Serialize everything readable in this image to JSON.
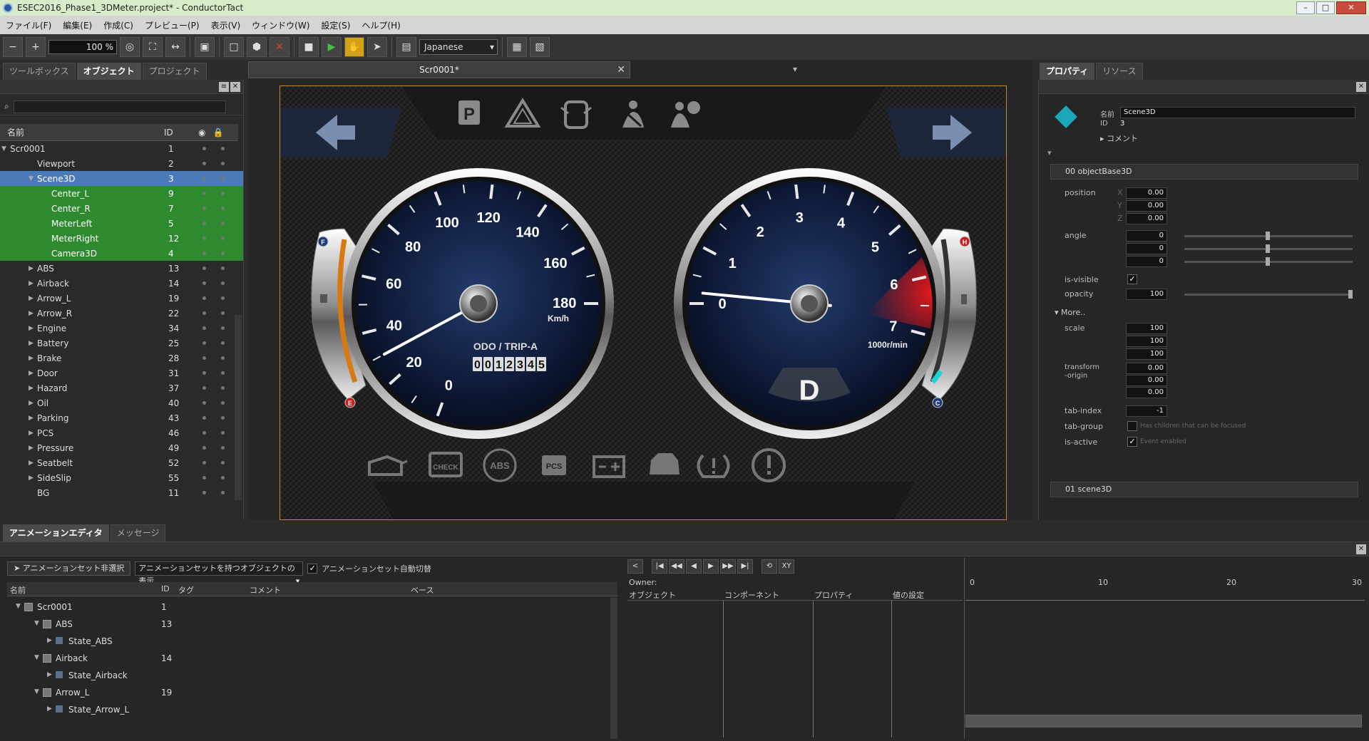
{
  "window": {
    "title": "ESEC2016_Phase1_3DMeter.project* - ConductorTact"
  },
  "menu": [
    "ファイル(F)",
    "編集(E)",
    "作成(C)",
    "プレビュー(P)",
    "表示(V)",
    "ウィンドウ(W)",
    "設定(S)",
    "ヘルプ(H)"
  ],
  "toolbar": {
    "zoom": "100 %",
    "language": "Japanese"
  },
  "left_tabs": [
    "ツールボックス",
    "オブジェクト",
    "プロジェクト"
  ],
  "object_tree": {
    "headers": {
      "name": "名前",
      "id": "ID"
    },
    "rows": [
      {
        "name": "Scr0001",
        "id": "1"
      },
      {
        "name": "Viewport",
        "id": "2"
      },
      {
        "name": "Scene3D",
        "id": "3"
      },
      {
        "name": "Center_L",
        "id": "9"
      },
      {
        "name": "Center_R",
        "id": "7"
      },
      {
        "name": "MeterLeft",
        "id": "5"
      },
      {
        "name": "MeterRight",
        "id": "12"
      },
      {
        "name": "Camera3D",
        "id": "4"
      },
      {
        "name": "ABS",
        "id": "13"
      },
      {
        "name": "Airback",
        "id": "14"
      },
      {
        "name": "Arrow_L",
        "id": "19"
      },
      {
        "name": "Arrow_R",
        "id": "22"
      },
      {
        "name": "Engine",
        "id": "34"
      },
      {
        "name": "Battery",
        "id": "25"
      },
      {
        "name": "Brake",
        "id": "28"
      },
      {
        "name": "Door",
        "id": "31"
      },
      {
        "name": "Hazard",
        "id": "37"
      },
      {
        "name": "Oil",
        "id": "40"
      },
      {
        "name": "Parking",
        "id": "43"
      },
      {
        "name": "PCS",
        "id": "46"
      },
      {
        "name": "Pressure",
        "id": "49"
      },
      {
        "name": "Seatbelt",
        "id": "52"
      },
      {
        "name": "SideSlip",
        "id": "55"
      },
      {
        "name": "BG",
        "id": "11"
      }
    ]
  },
  "document": {
    "tab": "Scr0001*"
  },
  "gauge_left": {
    "ticks": [
      "0",
      "20",
      "40",
      "60",
      "80",
      "100",
      "120",
      "140",
      "160",
      "180"
    ],
    "unit": "Km/h",
    "odo_label": "ODO / TRIP-A",
    "odo_digits": [
      "0",
      "0",
      "1",
      "2",
      "3",
      "4",
      "5"
    ],
    "fuel_top": "F",
    "fuel_bottom": "E",
    "speed": 30
  },
  "gauge_right": {
    "ticks": [
      "0",
      "1",
      "2",
      "3",
      "4",
      "5",
      "6",
      "7"
    ],
    "unit": "1000r/min",
    "gear": "D",
    "temp_top": "H",
    "temp_bottom": "C",
    "rpm": 0.2
  },
  "warning_labels": {
    "park": "P",
    "check": "CHECK",
    "abs": "ABS",
    "pcs": "PCS"
  },
  "right_tabs": [
    "プロパティ",
    "リソース"
  ],
  "properties": {
    "name_label": "名前",
    "name_value": "Scene3D",
    "id_label": "ID",
    "id_value": "3",
    "comment": "コメント",
    "section1": "00 objectBase3D",
    "position": {
      "label": "position",
      "x": "0.00",
      "y": "0.00",
      "z": "0.00"
    },
    "angle": {
      "label": "angle",
      "x": "0",
      "y": "0",
      "z": "0"
    },
    "is_visible": "is-visible",
    "opacity": {
      "label": "opacity",
      "value": "100",
      "unit": "%"
    },
    "more": "More..",
    "scale": {
      "label": "scale",
      "x": "100",
      "y": "100",
      "z": "100",
      "unit": "%"
    },
    "transform_origin": {
      "label": "transform",
      "label2": "-origin",
      "x": "0.00",
      "y": "0.00",
      "z": "0.00"
    },
    "tab_index": {
      "label": "tab-index",
      "value": "-1"
    },
    "tab_group": {
      "label": "tab-group",
      "hint": "Has children that can be focused"
    },
    "is_active": {
      "label": "is-active",
      "hint": "Event enabled"
    },
    "section2": "01 scene3D",
    "axes": [
      "X",
      "Y",
      "Z"
    ]
  },
  "bottom_tabs": [
    "アニメーションエディタ",
    "メッセージ"
  ],
  "anim": {
    "deselect": "アニメーションセット非選択",
    "filter": "アニメーションセットを持つオブジェクトの表示",
    "autoswitch": "アニメーションセット自動切替",
    "headers": {
      "name": "名前",
      "id": "ID",
      "tag": "タグ",
      "comment": "コメント",
      "base": "ベース"
    },
    "rows": [
      {
        "name": "Scr0001",
        "id": "1"
      },
      {
        "name": "ABS",
        "id": "13"
      },
      {
        "name": "State_ABS",
        "id": ""
      },
      {
        "name": "Airback",
        "id": "14"
      },
      {
        "name": "State_Airback",
        "id": ""
      },
      {
        "name": "Arrow_L",
        "id": "19"
      },
      {
        "name": "State_Arrow_L",
        "id": ""
      }
    ],
    "owner": "Owner:",
    "track_headers": {
      "object": "オブジェクト",
      "component": "コンポーネント",
      "property": "プロパティ",
      "value": "値の設定"
    },
    "xy": "XY",
    "timeline": [
      "0",
      "10",
      "20",
      "30"
    ]
  }
}
